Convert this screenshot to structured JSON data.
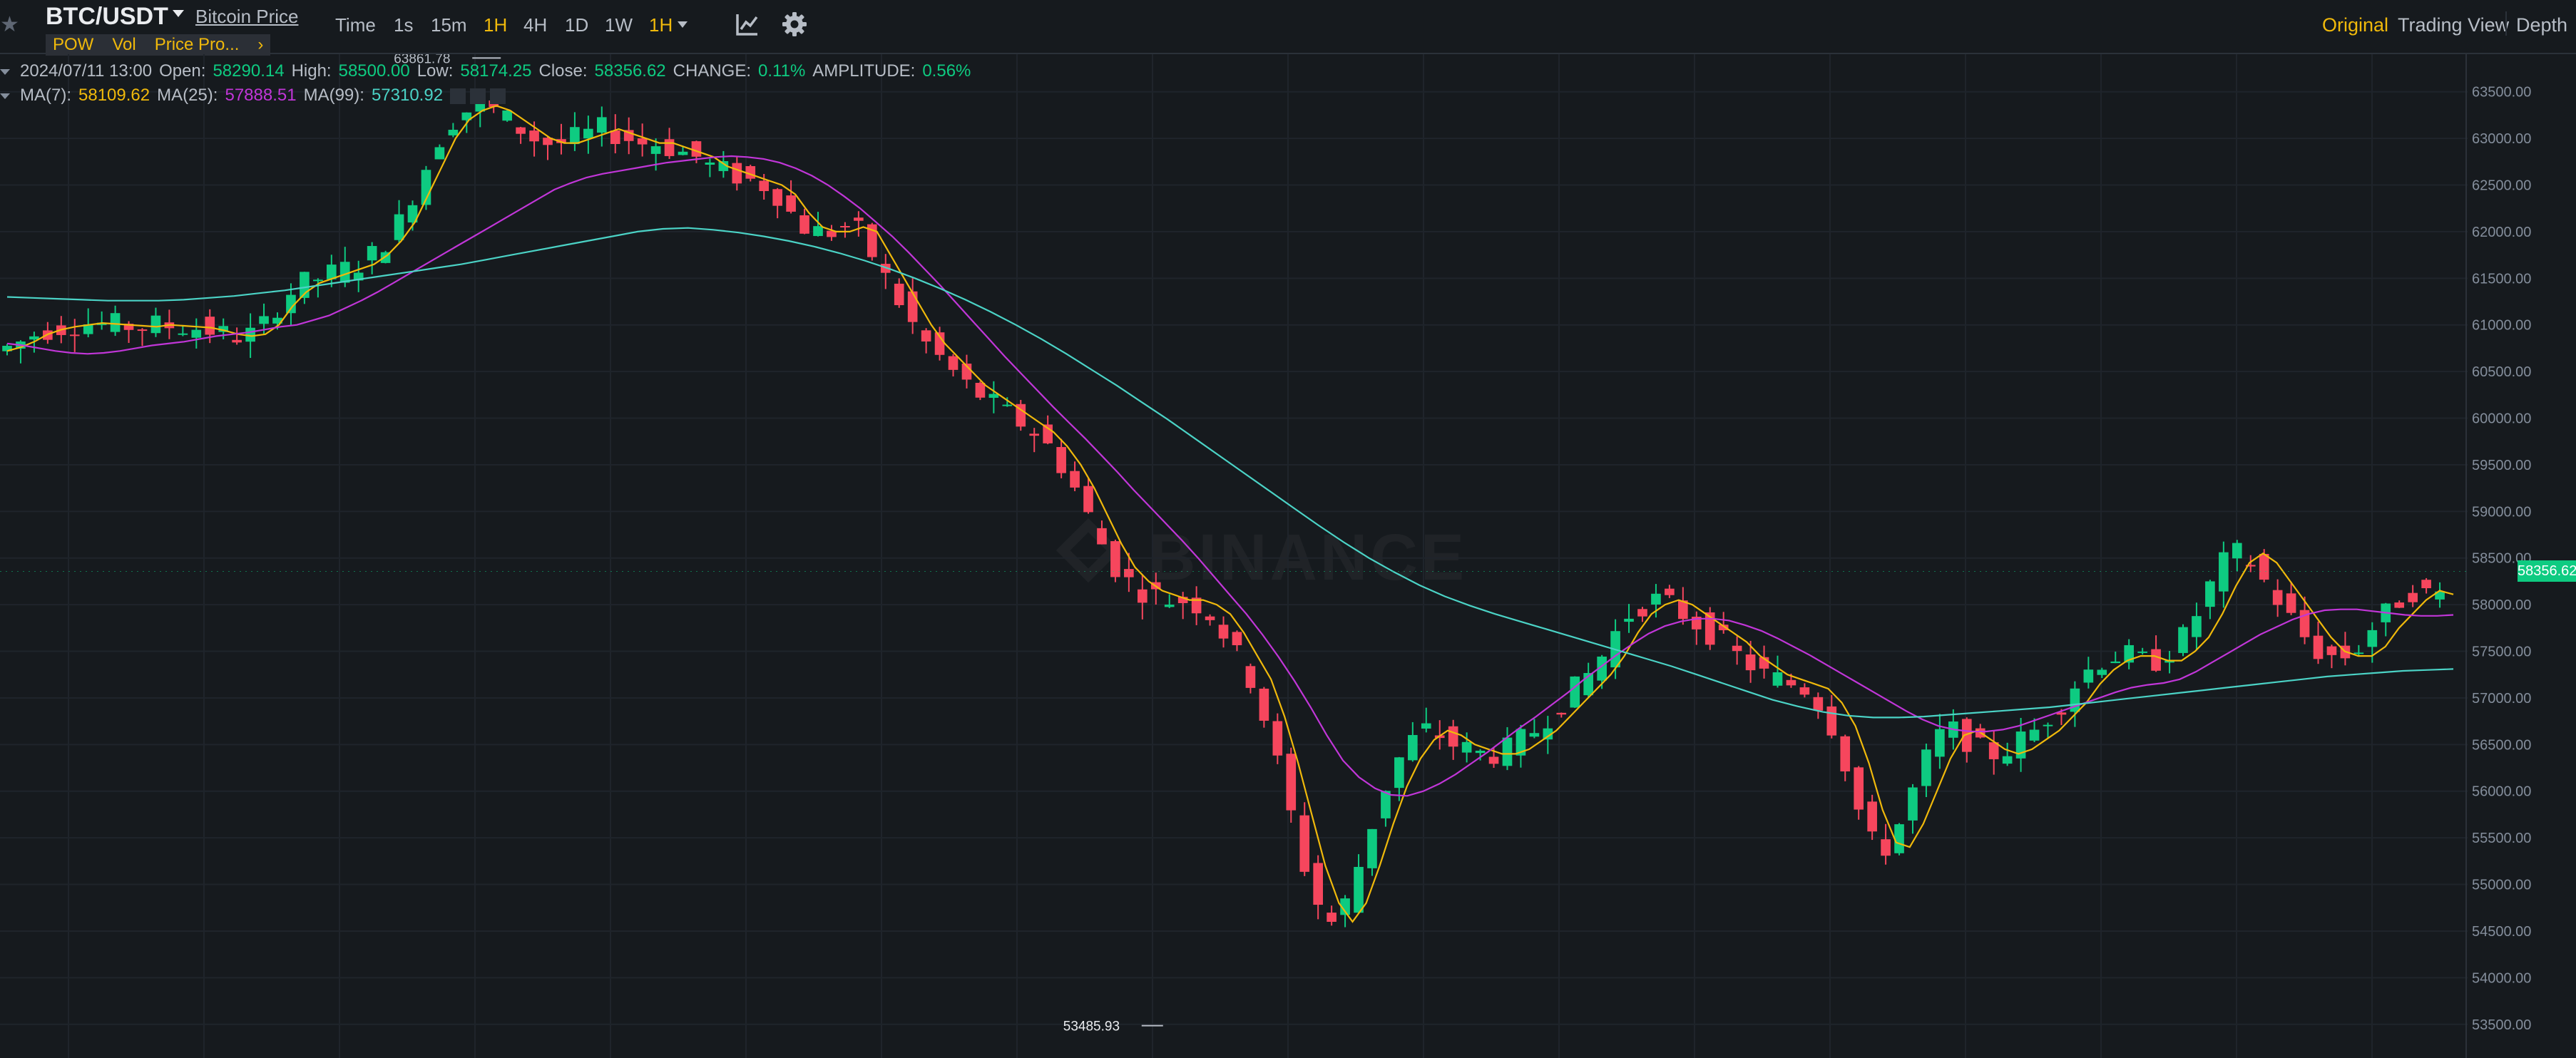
{
  "header": {
    "symbol": "BTC/USDT",
    "coin_link": "Bitcoin Price",
    "tags": [
      "POW",
      "Vol",
      "Price Pro...",
      "›"
    ],
    "timeframes": [
      "Time",
      "1s",
      "15m",
      "1H",
      "4H",
      "1D",
      "1W",
      "1H"
    ],
    "active_timeframe": "1H",
    "views": [
      "Original",
      "Trading View",
      "Depth"
    ],
    "active_view": "Original"
  },
  "ohlc": {
    "date": "2024/07/11 13:00",
    "open_label": "Open:",
    "open": "58290.14",
    "high_label": "High:",
    "high": "58500.00",
    "low_label": "Low:",
    "low": "58174.25",
    "close_label": "Close:",
    "close": "58356.62",
    "change_label": "CHANGE:",
    "change": "0.11%",
    "amplitude_label": "AMPLITUDE:",
    "amplitude": "0.56%"
  },
  "ma": {
    "ma7_label": "MA(7):",
    "ma7": "58109.62",
    "ma25_label": "MA(25):",
    "ma25": "57888.51",
    "ma99_label": "MA(99):",
    "ma99": "57310.92"
  },
  "watermark": "BINANCE",
  "colors": {
    "background": "#161a1e",
    "up": "#0ecb81",
    "down": "#f6465d",
    "accent": "#f0b90b",
    "ma7": "#f0b90b",
    "ma25": "#c136d8",
    "ma99": "#4bd3c6"
  },
  "chart_data": {
    "type": "candlestick",
    "interval": "1H",
    "price_axis_ticks": [
      "63500.00",
      "63000.00",
      "62500.00",
      "62000.00",
      "61500.00",
      "61000.00",
      "60500.00",
      "60000.00",
      "59500.00",
      "59000.00",
      "58500.00",
      "58000.00",
      "57500.00",
      "57000.00",
      "56500.00",
      "56000.00",
      "55500.00",
      "55000.00",
      "54500.00",
      "54000.00",
      "53500.00"
    ],
    "ylim": [
      53200,
      63750
    ],
    "last_price": "58356.62",
    "annotations": {
      "high": "63861.78",
      "low": "53485.93"
    },
    "series": [
      {
        "name": "MA(7)",
        "color": "#f0b90b",
        "values": [
          60720,
          60760,
          60820,
          60900,
          60950,
          60980,
          61000,
          61020,
          61010,
          61000,
          60990,
          60980,
          61000,
          60990,
          60980,
          60970,
          60940,
          60900,
          60880,
          60900,
          61000,
          61200,
          61350,
          61450,
          61500,
          61550,
          61600,
          61650,
          61750,
          61900,
          62100,
          62400,
          62700,
          63000,
          63200,
          63300,
          63350,
          63300,
          63200,
          63100,
          63000,
          62950,
          62950,
          63000,
          63050,
          63100,
          63050,
          63000,
          62950,
          62950,
          62900,
          62850,
          62800,
          62700,
          62650,
          62600,
          62550,
          62500,
          62400,
          62200,
          62050,
          62000,
          62000,
          62050,
          62000,
          61750,
          61500,
          61250,
          61000,
          60800,
          60650,
          60500,
          60350,
          60250,
          60150,
          60050,
          59950,
          59850,
          59700,
          59500,
          59250,
          58950,
          58650,
          58400,
          58250,
          58150,
          58100,
          58050,
          58050,
          58000,
          57900,
          57700,
          57450,
          57200,
          56800,
          56300,
          55750,
          55200,
          54800,
          54600,
          54800,
          55200,
          55650,
          56050,
          56350,
          56550,
          56650,
          56600,
          56500,
          56450,
          56400,
          56400,
          56450,
          56550,
          56650,
          56800,
          56950,
          57100,
          57250,
          57450,
          57700,
          57900,
          58000,
          58050,
          58000,
          57900,
          57800,
          57700,
          57600,
          57450,
          57350,
          57250,
          57200,
          57150,
          57100,
          56950,
          56700,
          56300,
          55800,
          55450,
          55400,
          55650,
          56000,
          56350,
          56600,
          56650,
          56550,
          56450,
          56400,
          56450,
          56550,
          56650,
          56800,
          56950,
          57150,
          57300,
          57400,
          57450,
          57450,
          57400,
          57400,
          57500,
          57650,
          57900,
          58200,
          58450,
          58550,
          58450,
          58250,
          58050,
          57850,
          57650,
          57500,
          57450,
          57450,
          57550,
          57750,
          57900,
          58050,
          58150,
          58110
        ]
      },
      {
        "name": "MA(25)",
        "color": "#c136d8",
        "values": [
          60800,
          60780,
          60750,
          60720,
          60700,
          60690,
          60700,
          60720,
          60750,
          60780,
          60800,
          60820,
          60850,
          60880,
          60900,
          60920,
          60950,
          60980,
          61000,
          61050,
          61100,
          61180,
          61260,
          61350,
          61450,
          61550,
          61650,
          61750,
          61850,
          61950,
          62050,
          62150,
          62250,
          62350,
          62450,
          62520,
          62580,
          62620,
          62650,
          62680,
          62710,
          62740,
          62760,
          62780,
          62800,
          62810,
          62800,
          62780,
          62740,
          62680,
          62600,
          62500,
          62380,
          62250,
          62100,
          61950,
          61780,
          61600,
          61420,
          61230,
          61040,
          60850,
          60660,
          60480,
          60300,
          60120,
          59950,
          59780,
          59600,
          59420,
          59230,
          59050,
          58870,
          58690,
          58500,
          58300,
          58100,
          57900,
          57680,
          57440,
          57180,
          56900,
          56600,
          56330,
          56150,
          56030,
          55960,
          55950,
          56000,
          56080,
          56180,
          56300,
          56420,
          56550,
          56680,
          56800,
          56930,
          57060,
          57200,
          57330,
          57460,
          57580,
          57690,
          57770,
          57820,
          57850,
          57850,
          57830,
          57780,
          57720,
          57640,
          57550,
          57460,
          57360,
          57260,
          57160,
          57060,
          56960,
          56860,
          56770,
          56700,
          56660,
          56640,
          56640,
          56660,
          56700,
          56760,
          56820,
          56880,
          56940,
          57000,
          57060,
          57110,
          57140,
          57160,
          57200,
          57280,
          57380,
          57480,
          57580,
          57680,
          57760,
          57840,
          57900,
          57940,
          57950,
          57950,
          57930,
          57910,
          57890,
          57880,
          57880,
          57890
        ]
      },
      {
        "name": "MA(99)",
        "color": "#4bd3c6",
        "values": [
          61300,
          61290,
          61280,
          61270,
          61260,
          61260,
          61260,
          61270,
          61290,
          61310,
          61340,
          61370,
          61410,
          61450,
          61490,
          61530,
          61570,
          61610,
          61650,
          61700,
          61750,
          61800,
          61850,
          61900,
          61950,
          62000,
          62030,
          62040,
          62020,
          61990,
          61950,
          61900,
          61840,
          61770,
          61690,
          61600,
          61500,
          61390,
          61270,
          61140,
          61000,
          60850,
          60690,
          60520,
          60350,
          60170,
          59990,
          59800,
          59610,
          59420,
          59230,
          59040,
          58850,
          58670,
          58500,
          58350,
          58210,
          58090,
          57990,
          57900,
          57820,
          57740,
          57660,
          57580,
          57500,
          57420,
          57340,
          57250,
          57160,
          57070,
          56980,
          56910,
          56850,
          56810,
          56790,
          56790,
          56800,
          56820,
          56840,
          56860,
          56880,
          56900,
          56930,
          56960,
          56990,
          57020,
          57050,
          57080,
          57110,
          57140,
          57170,
          57200,
          57230,
          57250,
          57270,
          57290,
          57300,
          57310
        ]
      }
    ]
  }
}
